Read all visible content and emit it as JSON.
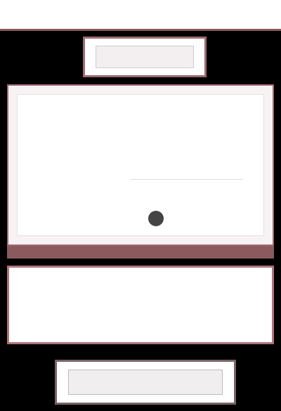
{
  "topbar": {
    "title": ""
  },
  "top_pad": {
    "button_label": ""
  },
  "card": {
    "heading": "",
    "subheading": "",
    "link": "",
    "rows": [
      {
        "label": ""
      },
      {
        "label": ""
      },
      {
        "label": ""
      }
    ],
    "field_value": "",
    "action_symbol": "",
    "side_link": ""
  },
  "banner": {
    "title": "",
    "text": ""
  },
  "bottom_pad": {
    "button_label": ""
  }
}
